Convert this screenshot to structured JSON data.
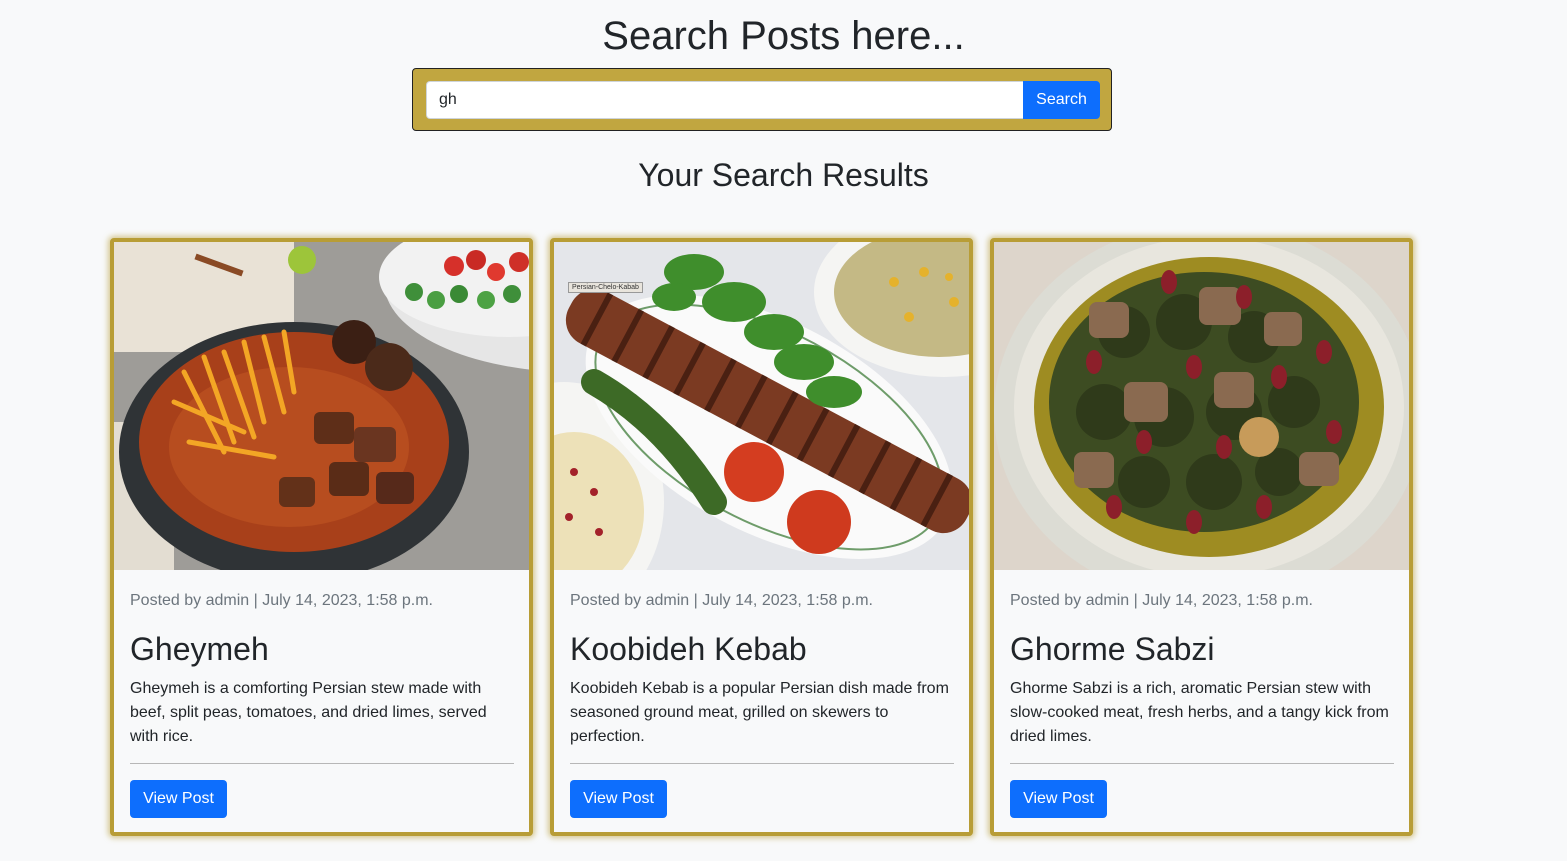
{
  "header": {
    "title": "Search Posts here..."
  },
  "search": {
    "value": "gh",
    "button_label": "Search"
  },
  "results": {
    "title": "Your Search Results",
    "posts": [
      {
        "meta": "Posted by admin | July 14, 2023, 1:58 p.m.",
        "title": "Gheymeh",
        "description": "Gheymeh is a comforting Persian stew made with beef, split peas, tomatoes, and dried limes, served with rice.",
        "button_label": "View Post"
      },
      {
        "meta": "Posted by admin | July 14, 2023, 1:58 p.m.",
        "title": "Koobideh Kebab",
        "description": "Koobideh Kebab is a popular Persian dish made from seasoned ground meat, grilled on skewers to perfection.",
        "button_label": "View Post",
        "image_label": "Persian-Chelo-Kabab"
      },
      {
        "meta": "Posted by admin | July 14, 2023, 1:58 p.m.",
        "title": "Ghorme Sabzi",
        "description": "Ghorme Sabzi is a rich, aromatic Persian stew with slow-cooked meat, fresh herbs, and a tangy kick from dried limes.",
        "button_label": "View Post"
      }
    ]
  },
  "colors": {
    "accent_gold": "#b89d36",
    "panel_gold": "#c1a640",
    "primary_blue": "#0d6efd"
  }
}
